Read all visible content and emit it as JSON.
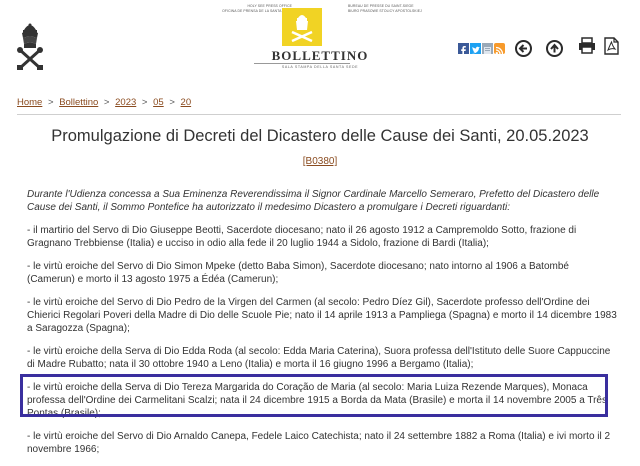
{
  "header": {
    "office_left": [
      "HOLY SEE PRESS OFFICE",
      "OFICINA DE PRENSA DE LA SANTA SEDE"
    ],
    "office_right": [
      "BUREAU DE PRESSE DU SAINT-SIEGE",
      "BIURO PRASOWE STOLICY APOSTOLSKIEJ"
    ],
    "logo_title": "BOLLETTINO",
    "logo_subtitle": "SALA STAMPA DELLA SANTA SEDE",
    "icons": [
      "facebook-icon",
      "twitter-icon",
      "generic-share-icon",
      "rss-icon",
      "back-arrow-icon",
      "up-arrow-icon",
      "print-icon",
      "pdf-icon"
    ]
  },
  "breadcrumb": {
    "items": [
      "Home",
      "Bollettino",
      "2023",
      "05",
      "20"
    ],
    "separator": ">"
  },
  "title": "Promulgazione di Decreti del Dicastero delle Cause dei Santi, 20.05.2023",
  "code": "[B0380]",
  "intro": "Durante l'Udienza concessa a Sua Eminenza Reverendissima il Signor Cardinale Marcello Semeraro, Prefetto del Dicastero delle Cause dei Santi, il Sommo Pontefice ha autorizzato il medesimo Dicastero a promulgare i Decreti riguardanti:",
  "items": [
    "- il martirio del Servo di Dio Giuseppe Beotti, Sacerdote diocesano; nato il 26 agosto 1912 a Campremoldo Sotto, frazione di Gragnano Trebbiense (Italia) e ucciso in odio alla fede il 20 luglio 1944 a Sidolo, frazione di Bardi (Italia);",
    "- le virtù eroiche del Servo di Dio Simon Mpeke (detto Baba Simon), Sacerdote diocesano; nato intorno al 1906 a Batombé (Camerun) e morto il 13 agosto 1975 a Édéa (Camerun);",
    "- le virtù eroiche del Servo di Dio Pedro de la Virgen del Carmen (al secolo: Pedro Díez Gil), Sacerdote professo dell'Ordine dei Chierici Regolari Poveri della Madre di Dio delle Scuole Pie; nato il 14 aprile 1913 a Pampliega (Spagna) e morto il 14 dicembre 1983 a Saragozza (Spagna);",
    "- le virtù eroiche della Serva di Dio Edda Roda (al secolo: Edda Maria Caterina), Suora professa dell'Istituto delle Suore Cappuccine di Madre Rubatto; nata il 30 ottobre 1940 a Leno (Italia) e morta il 16 giugno 1996 a Bergamo (Italia);",
    "- le virtù eroiche della Serva di Dio Tereza Margarida do Coração de Maria (al secolo: Maria Luiza Rezende Marques), Monaca professa dell'Ordine dei Carmelitani Scalzi; nata il 24 dicembre 1915 a Borda da Mata (Brasile) e morta il 14 novembre 2005 a Três Pontas (Brasile);",
    "- le virtù eroiche del Servo di Dio Arnaldo Canepa, Fedele Laico Catechista; nato il 24 settembre 1882 a Roma (Italia) e ivi morto il 2 novembre 1966;"
  ],
  "colors": {
    "link": "#8a4b1f",
    "highlight_border": "#3a2f9e",
    "emblem": "#f1d324"
  }
}
